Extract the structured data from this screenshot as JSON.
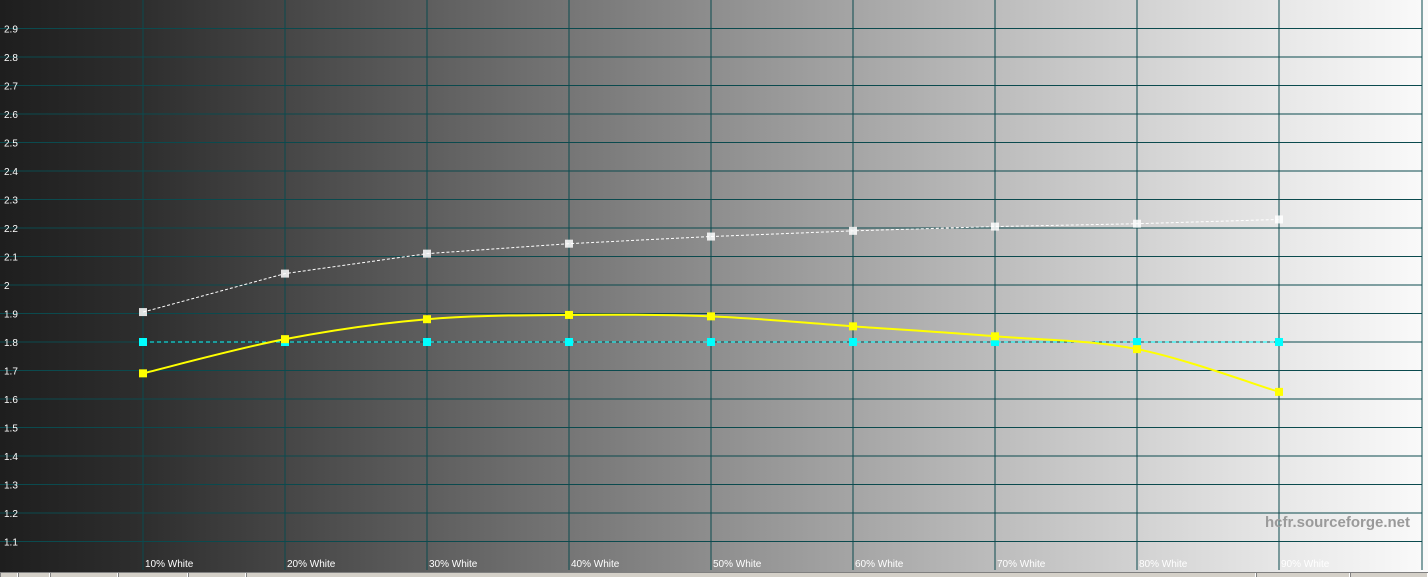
{
  "chart_data": {
    "type": "line",
    "categories": [
      "10% White",
      "20% White",
      "30% White",
      "40% White",
      "50% White",
      "60% White",
      "70% White",
      "80% White",
      "90% White"
    ],
    "y_ticks": [
      "1.1",
      "1.2",
      "1.3",
      "1.4",
      "1.5",
      "1.6",
      "1.7",
      "1.8",
      "1.9",
      "2",
      "2.1",
      "2.2",
      "2.3",
      "2.4",
      "2.5",
      "2.6",
      "2.7",
      "2.8",
      "2.9"
    ],
    "ylim": [
      1.0,
      2.95
    ],
    "grid": true,
    "series": [
      {
        "values": [
          1.69,
          1.81,
          1.88,
          1.895,
          1.89,
          1.855,
          1.82,
          1.775,
          1.625
        ],
        "color": "#ffff00",
        "style": "solid"
      },
      {
        "values": [
          1.8,
          1.8,
          1.8,
          1.8,
          1.8,
          1.8,
          1.8,
          1.8,
          1.8
        ],
        "color": "#00ffff",
        "style": "dashed"
      },
      {
        "values": [
          1.905,
          2.04,
          2.11,
          2.145,
          2.17,
          2.19,
          2.205,
          2.215,
          2.23
        ],
        "color": "#ffffff",
        "style": "dotted"
      }
    ]
  },
  "watermark": "hcfr.sourceforge.net",
  "colors": {
    "grid": "#0b4a4e",
    "tick_label": "#ffffff",
    "category_label": "#ffffff"
  }
}
